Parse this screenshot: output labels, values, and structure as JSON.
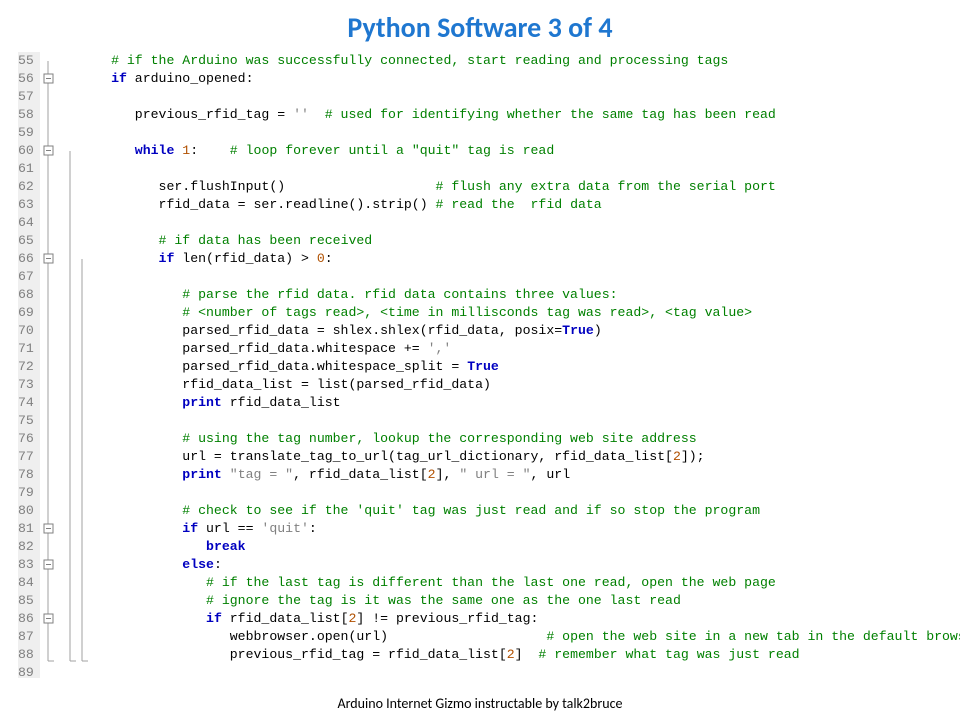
{
  "title": "Python Software 3 of 4",
  "caption": "Arduino Internet Gizmo instructable by talk2bruce",
  "line_start": 55,
  "line_end": 89,
  "code": [
    {
      "indent": 1,
      "tokens": [
        {
          "c": "cm",
          "t": "# if the Arduino was successfully connected, start reading and processing tags"
        }
      ]
    },
    {
      "indent": 1,
      "tokens": [
        {
          "c": "kw",
          "t": "if"
        },
        {
          "c": "id",
          "t": " arduino_opened:"
        }
      ]
    },
    {
      "indent": 0,
      "tokens": []
    },
    {
      "indent": 2,
      "tokens": [
        {
          "c": "id",
          "t": "previous_rfid_tag = "
        },
        {
          "c": "str",
          "t": "''"
        },
        {
          "c": "id",
          "t": "  "
        },
        {
          "c": "cm",
          "t": "# used for identifying whether the same tag has been read"
        }
      ]
    },
    {
      "indent": 0,
      "tokens": []
    },
    {
      "indent": 2,
      "tokens": [
        {
          "c": "kw",
          "t": "while"
        },
        {
          "c": "id",
          "t": " "
        },
        {
          "c": "num",
          "t": "1"
        },
        {
          "c": "id",
          "t": ":    "
        },
        {
          "c": "cm",
          "t": "# loop forever until a \"quit\" tag is read"
        }
      ]
    },
    {
      "indent": 0,
      "tokens": []
    },
    {
      "indent": 3,
      "tokens": [
        {
          "c": "id",
          "t": "ser.flushInput()                   "
        },
        {
          "c": "cm",
          "t": "# flush any extra data from the serial port"
        }
      ]
    },
    {
      "indent": 3,
      "tokens": [
        {
          "c": "id",
          "t": "rfid_data = ser.readline().strip() "
        },
        {
          "c": "cm",
          "t": "# read the  rfid data"
        }
      ]
    },
    {
      "indent": 0,
      "tokens": []
    },
    {
      "indent": 3,
      "tokens": [
        {
          "c": "cm",
          "t": "# if data has been received"
        }
      ]
    },
    {
      "indent": 3,
      "tokens": [
        {
          "c": "kw",
          "t": "if"
        },
        {
          "c": "id",
          "t": " len(rfid_data) > "
        },
        {
          "c": "num",
          "t": "0"
        },
        {
          "c": "id",
          "t": ":"
        }
      ]
    },
    {
      "indent": 0,
      "tokens": []
    },
    {
      "indent": 4,
      "tokens": [
        {
          "c": "cm",
          "t": "# parse the rfid data. rfid data contains three values:"
        }
      ]
    },
    {
      "indent": 4,
      "tokens": [
        {
          "c": "cm",
          "t": "# <number of tags read>, <time in millisconds tag was read>, <tag value>"
        }
      ]
    },
    {
      "indent": 4,
      "tokens": [
        {
          "c": "id",
          "t": "parsed_rfid_data = shlex.shlex(rfid_data, posix="
        },
        {
          "c": "kw",
          "t": "True"
        },
        {
          "c": "id",
          "t": ")"
        }
      ]
    },
    {
      "indent": 4,
      "tokens": [
        {
          "c": "id",
          "t": "parsed_rfid_data.whitespace += "
        },
        {
          "c": "str",
          "t": "','"
        }
      ]
    },
    {
      "indent": 4,
      "tokens": [
        {
          "c": "id",
          "t": "parsed_rfid_data.whitespace_split = "
        },
        {
          "c": "kw",
          "t": "True"
        }
      ]
    },
    {
      "indent": 4,
      "tokens": [
        {
          "c": "id",
          "t": "rfid_data_list = list(parsed_rfid_data)"
        }
      ]
    },
    {
      "indent": 4,
      "tokens": [
        {
          "c": "kw",
          "t": "print"
        },
        {
          "c": "id",
          "t": " rfid_data_list"
        }
      ]
    },
    {
      "indent": 0,
      "tokens": []
    },
    {
      "indent": 4,
      "tokens": [
        {
          "c": "cm",
          "t": "# using the tag number, lookup the corresponding web site address"
        }
      ]
    },
    {
      "indent": 4,
      "tokens": [
        {
          "c": "id",
          "t": "url = translate_tag_to_url(tag_url_dictionary, rfid_data_list["
        },
        {
          "c": "num",
          "t": "2"
        },
        {
          "c": "id",
          "t": "]);"
        }
      ]
    },
    {
      "indent": 4,
      "tokens": [
        {
          "c": "kw",
          "t": "print"
        },
        {
          "c": "id",
          "t": " "
        },
        {
          "c": "str",
          "t": "\"tag = \""
        },
        {
          "c": "id",
          "t": ", rfid_data_list["
        },
        {
          "c": "num",
          "t": "2"
        },
        {
          "c": "id",
          "t": "], "
        },
        {
          "c": "str",
          "t": "\" url = \""
        },
        {
          "c": "id",
          "t": ", url"
        }
      ]
    },
    {
      "indent": 0,
      "tokens": []
    },
    {
      "indent": 4,
      "tokens": [
        {
          "c": "cm",
          "t": "# check to see if the 'quit' tag was just read and if so stop the program"
        }
      ]
    },
    {
      "indent": 4,
      "tokens": [
        {
          "c": "kw",
          "t": "if"
        },
        {
          "c": "id",
          "t": " url == "
        },
        {
          "c": "str",
          "t": "'quit'"
        },
        {
          "c": "id",
          "t": ":"
        }
      ]
    },
    {
      "indent": 5,
      "tokens": [
        {
          "c": "kw",
          "t": "break"
        }
      ]
    },
    {
      "indent": 4,
      "tokens": [
        {
          "c": "kw",
          "t": "else"
        },
        {
          "c": "id",
          "t": ":"
        }
      ]
    },
    {
      "indent": 5,
      "tokens": [
        {
          "c": "cm",
          "t": "# if the last tag is different than the last one read, open the web page"
        }
      ]
    },
    {
      "indent": 5,
      "tokens": [
        {
          "c": "cm",
          "t": "# ignore the tag is it was the same one as the one last read"
        }
      ]
    },
    {
      "indent": 5,
      "tokens": [
        {
          "c": "kw",
          "t": "if"
        },
        {
          "c": "id",
          "t": " rfid_data_list["
        },
        {
          "c": "num",
          "t": "2"
        },
        {
          "c": "id",
          "t": "] != previous_rfid_tag:"
        }
      ]
    },
    {
      "indent": 6,
      "tokens": [
        {
          "c": "id",
          "t": "webbrowser.open(url)                    "
        },
        {
          "c": "cm",
          "t": "# open the web site in a new tab in the default browser"
        }
      ]
    },
    {
      "indent": 6,
      "tokens": [
        {
          "c": "id",
          "t": "previous_rfid_tag = rfid_data_list["
        },
        {
          "c": "num",
          "t": "2"
        },
        {
          "c": "id",
          "t": "]  "
        },
        {
          "c": "cm",
          "t": "# remember what tag was just read"
        }
      ]
    },
    {
      "indent": 0,
      "tokens": []
    }
  ],
  "fold_marks": [
    {
      "line": 56,
      "depth": 0
    },
    {
      "line": 60,
      "depth": 0
    },
    {
      "line": 66,
      "depth": 0
    },
    {
      "line": 81,
      "depth": 0
    },
    {
      "line": 83,
      "depth": 0
    },
    {
      "line": 86,
      "depth": 0
    }
  ],
  "guide_lines": [
    {
      "x": 8,
      "from": 55,
      "to": 88
    },
    {
      "x": 30,
      "from": 60,
      "to": 88
    },
    {
      "x": 42,
      "from": 66,
      "to": 88
    }
  ]
}
